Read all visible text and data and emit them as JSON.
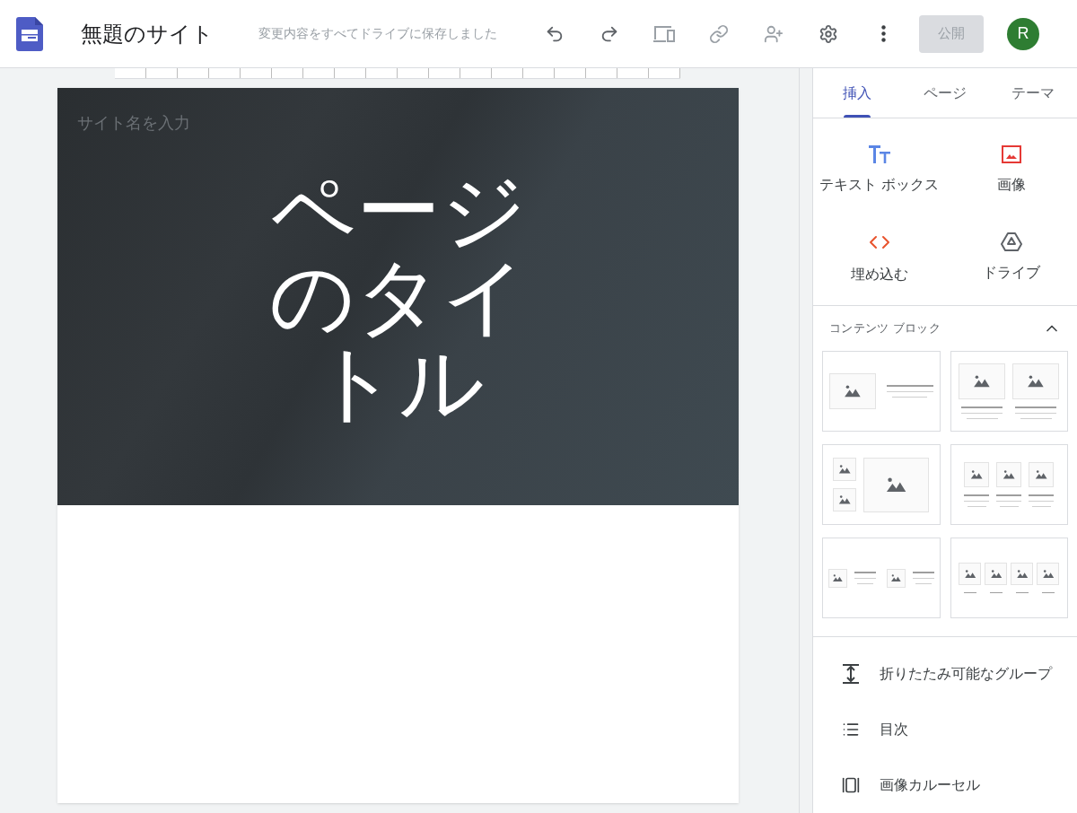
{
  "header": {
    "title": "無題のサイト",
    "save_status": "変更内容をすべてドライブに保存しました",
    "publish": {
      "label": "公開",
      "disabled": true
    },
    "avatar": "R"
  },
  "page": {
    "site_name_placeholder": "サイト名を入力",
    "title": "ページのタイトル"
  },
  "tabs": [
    {
      "label": "挿入",
      "selected": true
    },
    {
      "label": "ページ",
      "selected": false
    },
    {
      "label": "テーマ",
      "selected": false
    }
  ],
  "insert_items": [
    {
      "kind": "textbox",
      "label": "テキスト ボックス"
    },
    {
      "kind": "image",
      "label": "画像"
    },
    {
      "kind": "embed",
      "label": "埋め込む"
    },
    {
      "kind": "drive",
      "label": "ドライブ"
    }
  ],
  "content_blocks": {
    "title": "コンテンツ ブロック",
    "expanded": true,
    "layouts": [
      {
        "kind": "image-text"
      },
      {
        "kind": "two-images"
      },
      {
        "kind": "image-grid"
      },
      {
        "kind": "three-columns"
      },
      {
        "kind": "two-image-text"
      },
      {
        "kind": "four-columns"
      }
    ]
  },
  "components": [
    {
      "kind": "collapsible",
      "label": "折りたたみ可能なグループ"
    },
    {
      "kind": "toc",
      "label": "目次"
    },
    {
      "kind": "carousel",
      "label": "画像カルーセル"
    }
  ]
}
